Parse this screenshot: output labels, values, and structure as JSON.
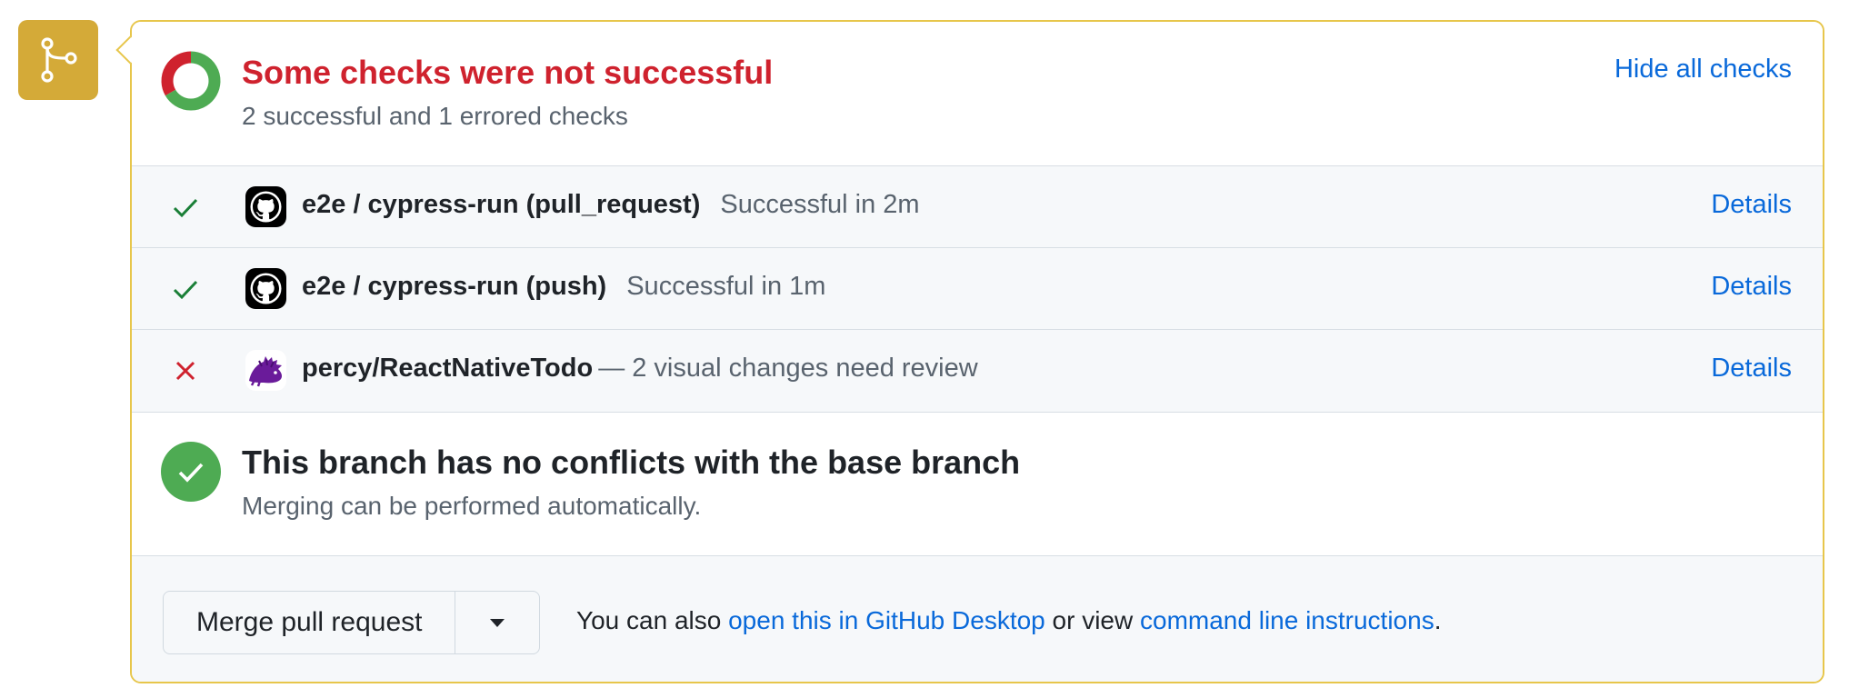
{
  "icons": {
    "branch": "git-branch-icon",
    "status_donut": "status-donut-icon",
    "check_success": "check-icon",
    "check_error": "x-icon",
    "github": "github-icon",
    "percy": "percy-hedgehog-icon",
    "merge_ok": "check-circle-icon",
    "dropdown": "triangle-down-icon"
  },
  "colors": {
    "accent": "#0969da",
    "error": "#cf222e",
    "success": "#1a7f37",
    "success_circle": "#4eab53",
    "donut_success": "#4eab53",
    "donut_error": "#cf222e",
    "badge": "#d4aa38",
    "border_warning": "#e7c64b",
    "percy": "#6a1b9a"
  },
  "checks_header": {
    "title": "Some checks were not successful",
    "subtitle": "2 successful and 1 errored checks",
    "hide_link": "Hide all checks",
    "successful_count": 2,
    "errored_count": 1
  },
  "checks": [
    {
      "status": "success",
      "app": "github",
      "name": "e2e / cypress-run (pull_request)",
      "description": "Successful in 2m",
      "details": "Details"
    },
    {
      "status": "success",
      "app": "github",
      "name": "e2e / cypress-run (push)",
      "description": "Successful in 1m",
      "details": "Details"
    },
    {
      "status": "error",
      "app": "percy",
      "name": "percy/ReactNativeTodo",
      "description": "— 2 visual changes need review",
      "details": "Details"
    }
  ],
  "merge_status": {
    "title": "This branch has no conflicts with the base branch",
    "subtitle": "Merging can be performed automatically."
  },
  "actions": {
    "merge_button": "Merge pull request",
    "text_before": "You can also ",
    "desktop_link": "open this in GitHub Desktop",
    "text_middle": " or view ",
    "cli_link": "command line instructions",
    "text_after": "."
  }
}
